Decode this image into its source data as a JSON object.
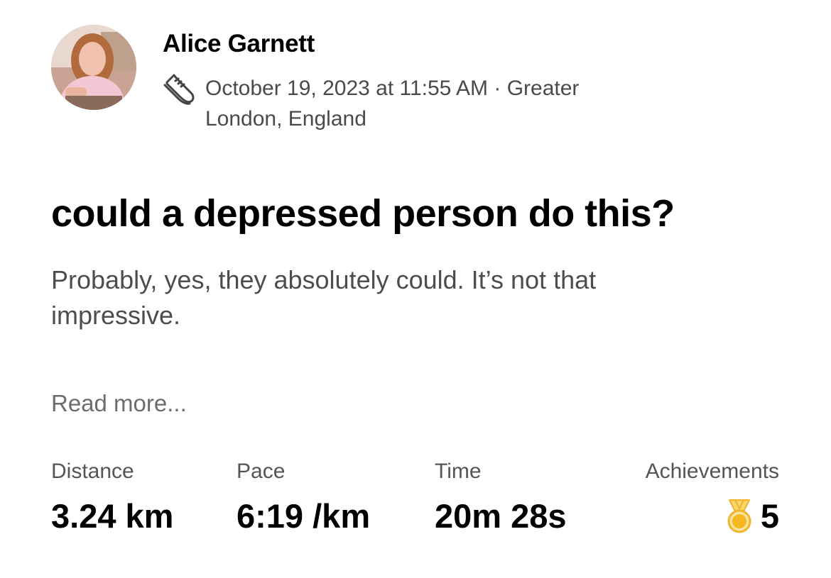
{
  "athlete": {
    "name": "Alice Garnett",
    "activity_icon": "running-shoe-icon",
    "meta_line": "October 19, 2023 at 11:55 AM · Greater London, England"
  },
  "activity": {
    "title": "could a depressed person do this?",
    "description": "Probably, yes, they absolutely could. It’s not that impressive.",
    "read_more": "Read more..."
  },
  "stats": {
    "distance": {
      "label": "Distance",
      "value": "3.24 km"
    },
    "pace": {
      "label": "Pace",
      "value": "6:19 /km"
    },
    "time": {
      "label": "Time",
      "value": "20m 28s"
    },
    "achievements": {
      "label": "Achievements",
      "value": "5",
      "icon": "medal-icon"
    }
  },
  "colors": {
    "text_primary": "#000000",
    "text_secondary": "#4a4a4a",
    "medal_gold": "#f5b91f"
  }
}
